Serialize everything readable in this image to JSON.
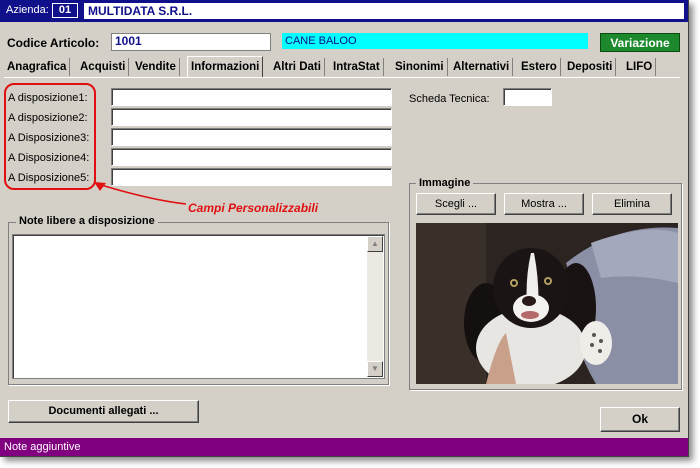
{
  "header": {
    "azienda_label": "Azienda:",
    "azienda_code": "01",
    "azienda_name": "MULTIDATA S.R.L."
  },
  "articolo": {
    "label": "Codice Articolo:",
    "code": "1001",
    "description": "CANE BALOO",
    "variazione_label": "Variazione"
  },
  "tabs": [
    {
      "label": "Anagrafica"
    },
    {
      "label": "Acquisti"
    },
    {
      "label": "Vendite"
    },
    {
      "label": "Informazioni",
      "active": true
    },
    {
      "label": "Altri Dati"
    },
    {
      "label": "IntraStat"
    },
    {
      "label": "Sinonimi"
    },
    {
      "label": "Alternativi"
    },
    {
      "label": "Estero"
    },
    {
      "label": "Depositi"
    },
    {
      "label": "LIFO"
    }
  ],
  "fields": [
    {
      "label": "A disposizione1:",
      "value": ""
    },
    {
      "label": "A disposizione2:",
      "value": ""
    },
    {
      "label": "A Disposizione3:",
      "value": ""
    },
    {
      "label": "A Disposizione4:",
      "value": ""
    },
    {
      "label": "A Disposizione5:",
      "value": ""
    }
  ],
  "scheda": {
    "label": "Scheda Tecnica:",
    "value": ""
  },
  "annotation": "Campi Personalizzabili",
  "note": {
    "title": "Note libere a disposizione",
    "value": ""
  },
  "immagine": {
    "title": "Immagine",
    "scegli": "Scegli ...",
    "mostra": "Mostra ...",
    "elimina": "Elimina"
  },
  "buttons": {
    "documenti": "Documenti allegati ...",
    "ok": "Ok"
  },
  "status": "Note aggiuntive",
  "colors": {
    "title_blue": "#10108a",
    "cyan": "#00ffff",
    "green": "#1c8a2c",
    "status_purple": "#800080",
    "annotation_red": "#e01010"
  }
}
